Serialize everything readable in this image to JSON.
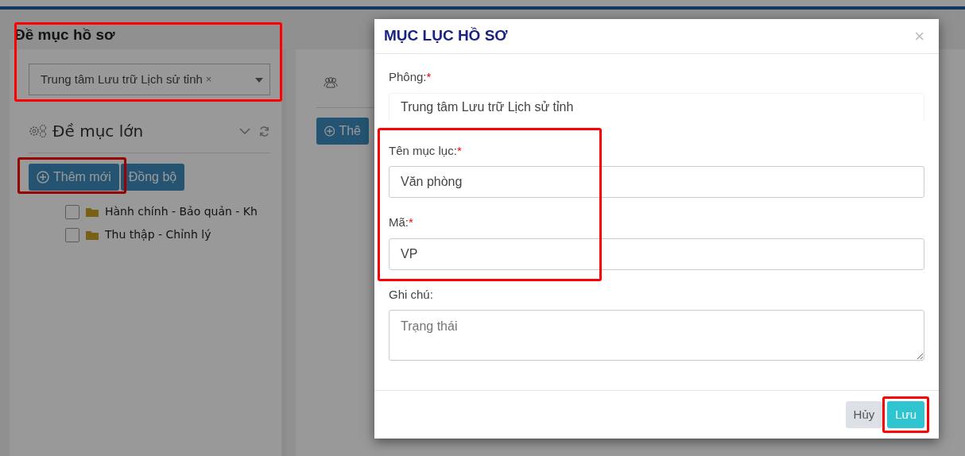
{
  "page": {
    "section_title": "Đề mục hồ sơ",
    "section_highlighted": true,
    "fonds_select": {
      "value": "Trung tâm Lưu trữ Lịch sử tỉnh",
      "clear": "×"
    }
  },
  "left_panel": {
    "title": "Đề mục lớn",
    "buttons": [
      {
        "label": "Thêm mới",
        "kind": "add",
        "highlighted": true
      },
      {
        "label": "Đồng bộ",
        "kind": "plain",
        "highlighted": false
      }
    ],
    "tree": [
      {
        "label": "Hành chính - Bảo quản - Kh",
        "checked": false
      },
      {
        "label": "Thu thập - Chỉnh lý",
        "checked": false
      }
    ]
  },
  "right_panel": {
    "button": {
      "label": "Thê"
    }
  },
  "modal": {
    "title": "MỤC LỤC HỒ SƠ",
    "close": "×",
    "fields": [
      {
        "label": "Phông:",
        "mark": "*",
        "kind": "readonly",
        "value": "Trung tâm Lưu trữ Lịch sử tỉnh",
        "highlighted": false
      },
      {
        "label": "Tên mục lục:",
        "mark": "*",
        "kind": "input",
        "value": "Văn phòng",
        "highlighted": true
      },
      {
        "label": "Mã:",
        "mark": "*",
        "kind": "input",
        "value": "VP",
        "highlighted": true
      },
      {
        "label": "Ghi chú:",
        "kind": "textarea",
        "placeholder": "Trạng thái",
        "highlighted": false
      }
    ],
    "buttons": [
      {
        "label": "Hủy",
        "kind": "cancel",
        "highlighted": false
      },
      {
        "label": "Lưu",
        "kind": "save",
        "highlighted": true
      }
    ]
  }
}
